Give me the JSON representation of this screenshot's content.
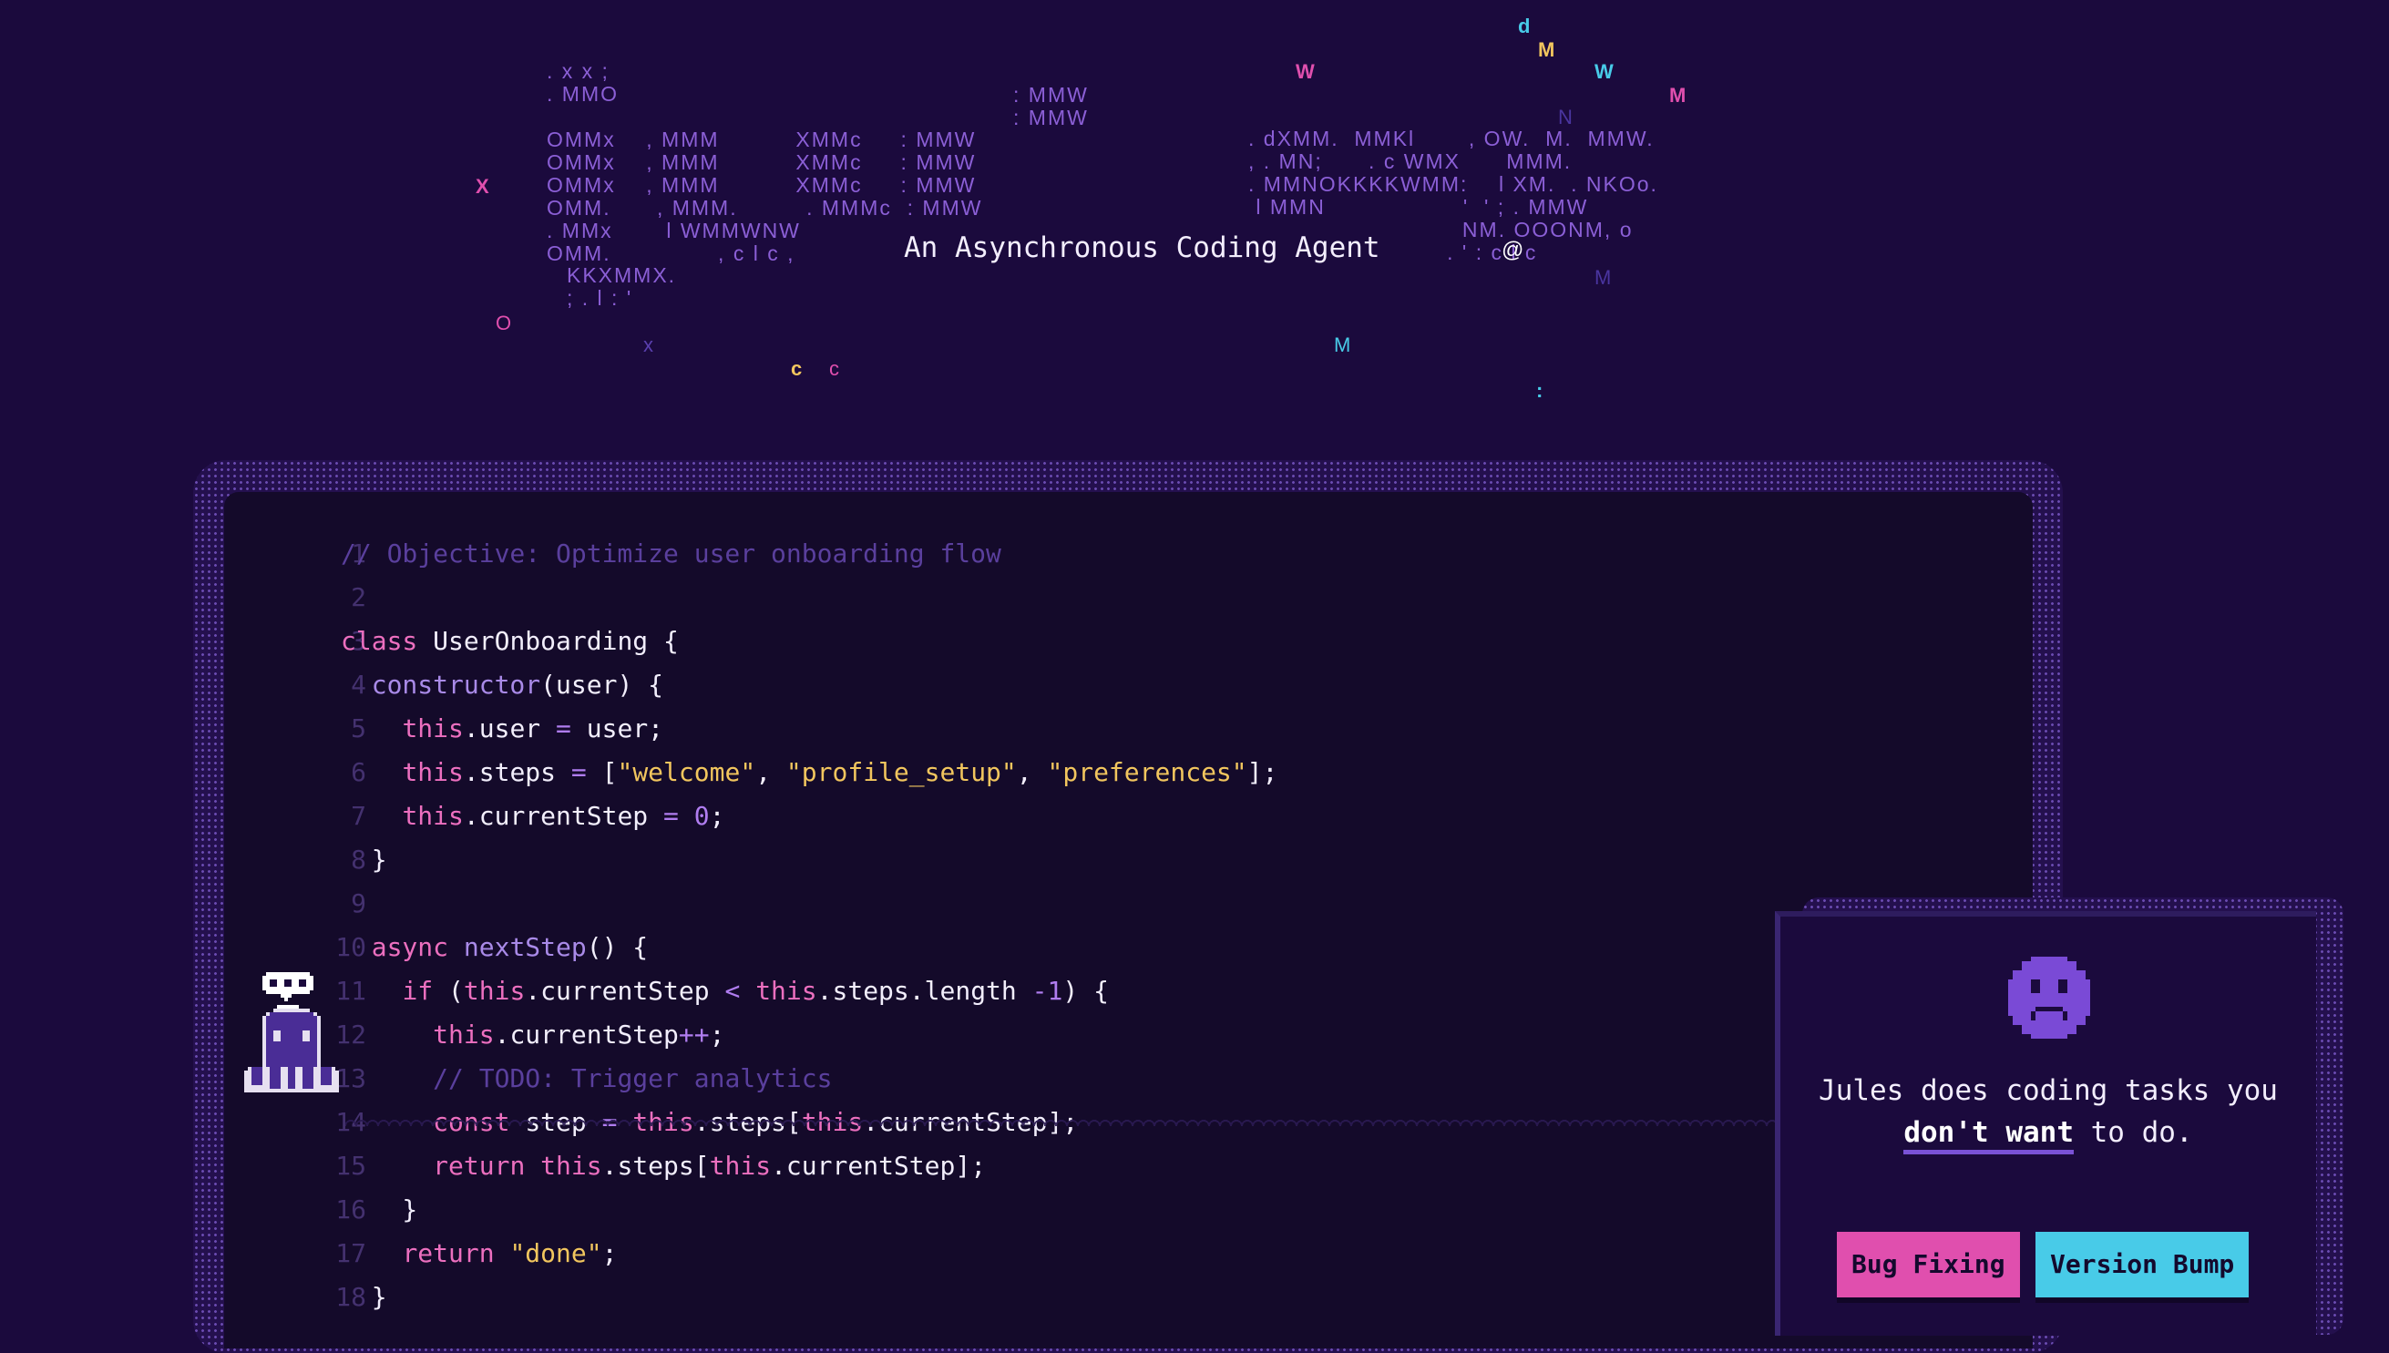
{
  "banner": {
    "ascii_left": ". x x ;\n. MMO\n\nOMMx    , MMM          XMMc     : MMW\nOMMx    , MMM          XMMc     : MMW\nOMMx    , MMM          XMMc     : MMW\nOMM.      , MMM.         . MMMc  : MMW\n. MMx       l WMMWNW\nOMM.              , c l c ,\n",
    "ascii_left_top": ": MMW\n: MMW",
    "ascii_kxmmx": "KKXMMX.\n; . l : '",
    "ascii_right": ". dXMM.  MMKl       , OW.  M.  MMW.\n, . MN;      . c WMX      MMM.\n. MMNOKKKKWMM:    l XM.  . NKOo.\n l MMN                  '  ' ; . MMW\n                            NM. OOONM, o\n                          . ' : c l c",
    "tagline": "An Asynchronous Coding Agent",
    "tagline_at": "@",
    "glyphs": {
      "d": "d",
      "M1": "M",
      "W1": "W",
      "W2": "W",
      "M2": "M",
      "N": "N",
      "X": "X",
      "O": "O",
      "x": "x",
      "c1": "c",
      "c2": "c",
      "M3": "M",
      "M4": "M",
      "colon": ":"
    }
  },
  "editor": {
    "lines": [
      {
        "n": "1",
        "tokens": [
          [
            "cm",
            "// Objective: Optimize user onboarding flow"
          ]
        ]
      },
      {
        "n": "2",
        "tokens": []
      },
      {
        "n": "3",
        "tokens": [
          [
            "kw",
            "class "
          ],
          [
            "pl",
            "UserOnboarding {"
          ]
        ]
      },
      {
        "n": "4",
        "tokens": [
          [
            "pl",
            "  "
          ],
          [
            "fn",
            "constructor"
          ],
          [
            "pl",
            "(user) {"
          ]
        ]
      },
      {
        "n": "5",
        "tokens": [
          [
            "pl",
            "    "
          ],
          [
            "kw",
            "this"
          ],
          [
            "pl",
            ".user "
          ],
          [
            "op",
            "="
          ],
          [
            "pl",
            " user;"
          ]
        ]
      },
      {
        "n": "6",
        "tokens": [
          [
            "pl",
            "    "
          ],
          [
            "kw",
            "this"
          ],
          [
            "pl",
            ".steps "
          ],
          [
            "op",
            "="
          ],
          [
            "pl",
            " ["
          ],
          [
            "str",
            "\"welcome\""
          ],
          [
            "pl",
            ", "
          ],
          [
            "str",
            "\"profile_setup\""
          ],
          [
            "pl",
            ", "
          ],
          [
            "str",
            "\"preferences\""
          ],
          [
            "pl",
            "];"
          ]
        ]
      },
      {
        "n": "7",
        "tokens": [
          [
            "pl",
            "    "
          ],
          [
            "kw",
            "this"
          ],
          [
            "pl",
            ".currentStep "
          ],
          [
            "op",
            "="
          ],
          [
            "pl",
            " "
          ],
          [
            "num",
            "0"
          ],
          [
            "pl",
            ";"
          ]
        ]
      },
      {
        "n": "8",
        "tokens": [
          [
            "pl",
            "  }"
          ]
        ]
      },
      {
        "n": "9",
        "tokens": []
      },
      {
        "n": "10",
        "tokens": [
          [
            "pl",
            "  "
          ],
          [
            "kw",
            "async "
          ],
          [
            "fn",
            "nextStep"
          ],
          [
            "pl",
            "() {"
          ]
        ]
      },
      {
        "n": "11",
        "tokens": [
          [
            "pl",
            "    "
          ],
          [
            "kw",
            "if "
          ],
          [
            "pl",
            "("
          ],
          [
            "kw",
            "this"
          ],
          [
            "pl",
            ".currentStep "
          ],
          [
            "op",
            "<"
          ],
          [
            "pl",
            " "
          ],
          [
            "kw",
            "this"
          ],
          [
            "pl",
            ".steps.length "
          ],
          [
            "op",
            "-1"
          ],
          [
            "pl",
            ") {"
          ]
        ]
      },
      {
        "n": "12",
        "tokens": [
          [
            "pl",
            "      "
          ],
          [
            "kw",
            "this"
          ],
          [
            "pl",
            ".currentStep"
          ],
          [
            "op",
            "++"
          ],
          [
            "pl",
            ";"
          ]
        ]
      },
      {
        "n": "13",
        "tokens": [
          [
            "pl",
            "      "
          ],
          [
            "cm",
            "// TODO: Trigger analytics"
          ]
        ]
      },
      {
        "n": "14",
        "tokens": [
          [
            "pl",
            "      "
          ],
          [
            "kw",
            "const "
          ],
          [
            "pl",
            "step "
          ],
          [
            "op",
            "="
          ],
          [
            "pl",
            " "
          ],
          [
            "kw",
            "this"
          ],
          [
            "pl",
            ".steps["
          ],
          [
            "kw",
            "this"
          ],
          [
            "pl",
            ".currentStep];"
          ]
        ]
      },
      {
        "n": "15",
        "tokens": [
          [
            "pl",
            "      "
          ],
          [
            "kw",
            "return "
          ],
          [
            "kw",
            "this"
          ],
          [
            "pl",
            ".steps["
          ],
          [
            "kw",
            "this"
          ],
          [
            "pl",
            ".currentStep];"
          ]
        ]
      },
      {
        "n": "16",
        "tokens": [
          [
            "pl",
            "    }"
          ]
        ]
      },
      {
        "n": "17",
        "tokens": [
          [
            "pl",
            "    "
          ],
          [
            "kw",
            "return "
          ],
          [
            "str",
            "\"done\""
          ],
          [
            "pl",
            ";"
          ]
        ]
      },
      {
        "n": "18",
        "tokens": [
          [
            "pl",
            "  }"
          ]
        ]
      }
    ]
  },
  "card": {
    "text_before": "Jules does coding tasks you",
    "text_strong": "don't want",
    "text_after": " to do.",
    "chips": [
      "Bug Fixing",
      "Version Bump"
    ]
  },
  "colors": {
    "background": "#1b0a3d",
    "keyword": "#ec6fbf",
    "function": "#a98ae8",
    "string": "#f2c65e",
    "comment": "#5a3f9d",
    "chip_pink": "#e04fae",
    "chip_cyan": "#48cbe8"
  },
  "icons": [
    "mascot-octopus-icon",
    "speech-bubble-icon",
    "sad-face-icon"
  ]
}
